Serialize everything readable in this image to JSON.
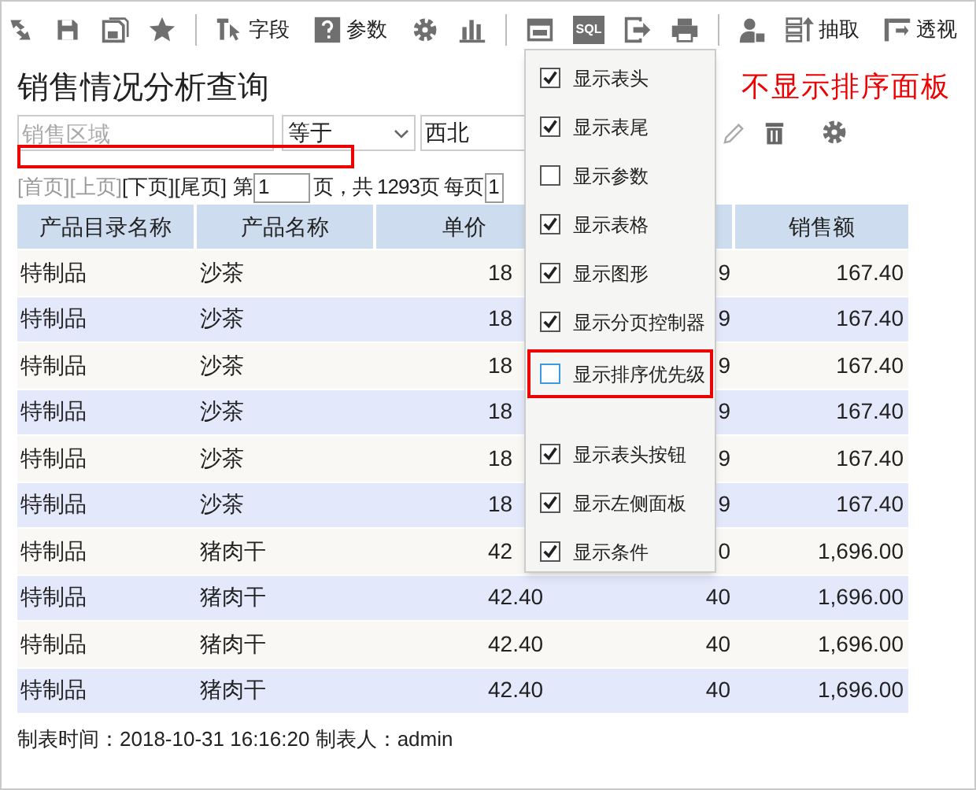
{
  "toolbar": [
    {
      "kind": "refresh"
    },
    {
      "kind": "save"
    },
    {
      "kind": "save-as"
    },
    {
      "kind": "star"
    },
    {
      "kind": "sep"
    },
    {
      "kind": "field",
      "label": "字段"
    },
    {
      "kind": "help",
      "label": "参数"
    },
    {
      "kind": "gear"
    },
    {
      "kind": "chart"
    },
    {
      "kind": "sep"
    },
    {
      "kind": "layout"
    },
    {
      "kind": "sql",
      "label": "SQL"
    },
    {
      "kind": "export"
    },
    {
      "kind": "print"
    },
    {
      "kind": "sep"
    },
    {
      "kind": "user"
    },
    {
      "kind": "extract",
      "label": "抽取"
    },
    {
      "kind": "pivot",
      "label": "透视"
    }
  ],
  "title": "销售情况分析查询",
  "annotation": "不显示排序面板",
  "filter": {
    "field_placeholder": "销售区域",
    "operator": "等于",
    "value": "西北"
  },
  "pager": {
    "first": "[首页]",
    "prev": "[上页]",
    "next": "[下页]",
    "last": "[尾页]",
    "page_prefix": "第",
    "page": "1",
    "page_suffix": "页，共 1293页 每页",
    "page_size": "1"
  },
  "table": {
    "columns": [
      "产品目录名称",
      "产品名称",
      "单价",
      "",
      "销售额"
    ],
    "rows": [
      [
        "特制品",
        "沙茶",
        "18",
        "9",
        "167.40"
      ],
      [
        "特制品",
        "沙茶",
        "18",
        "9",
        "167.40"
      ],
      [
        "特制品",
        "沙茶",
        "18",
        "9",
        "167.40"
      ],
      [
        "特制品",
        "沙茶",
        "18",
        "9",
        "167.40"
      ],
      [
        "特制品",
        "沙茶",
        "18",
        "9",
        "167.40"
      ],
      [
        "特制品",
        "沙茶",
        "18",
        "9",
        "167.40"
      ],
      [
        "特制品",
        "猪肉干",
        "42",
        "0",
        "1,696.00"
      ],
      [
        "特制品",
        "猪肉干",
        "42.40",
        "40",
        "1,696.00"
      ],
      [
        "特制品",
        "猪肉干",
        "42.40",
        "40",
        "1,696.00"
      ],
      [
        "特制品",
        "猪肉干",
        "42.40",
        "40",
        "1,696.00"
      ]
    ]
  },
  "footer": "制表时间：2018-10-31 16:16:20 制表人：admin",
  "menu": {
    "groups": [
      [
        {
          "label": "显示表头",
          "checked": true,
          "highlighted": false
        },
        {
          "label": "显示表尾",
          "checked": true,
          "highlighted": false
        },
        {
          "label": "显示参数",
          "checked": false,
          "highlighted": false
        },
        {
          "label": "显示表格",
          "checked": true,
          "highlighted": false
        },
        {
          "label": "显示图形",
          "checked": true,
          "highlighted": false
        },
        {
          "label": "显示分页控制器",
          "checked": true,
          "highlighted": false
        },
        {
          "label": "显示排序优先级",
          "checked": false,
          "highlighted": true
        }
      ],
      [
        {
          "label": "显示表头按钮",
          "checked": true,
          "highlighted": false
        },
        {
          "label": "显示左侧面板",
          "checked": true,
          "highlighted": false
        },
        {
          "label": "显示条件",
          "checked": true,
          "highlighted": false
        }
      ]
    ]
  }
}
